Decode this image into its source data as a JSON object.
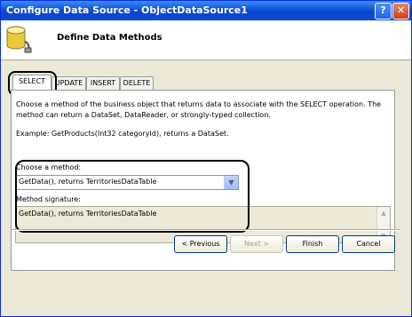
{
  "window": {
    "title": "Configure Data Source - ObjectDataSource1",
    "help_label": "?",
    "close_label": "✕"
  },
  "header": {
    "title": "Define Data Methods"
  },
  "tabs": [
    {
      "label": "SELECT",
      "active": true
    },
    {
      "label": "UPDATE",
      "active": false
    },
    {
      "label": "INSERT",
      "active": false
    },
    {
      "label": "DELETE",
      "active": false
    }
  ],
  "panel": {
    "description": "Choose a method of the business object that returns data to associate with the SELECT operation. The method can return a DataSet, DataReader, or strongly-typed collection.",
    "example": "Example: GetProducts(Int32 categoryId), returns a DataSet.",
    "choose_label": "Choose a method:",
    "method_value": "GetData(), returns TerritoriesDataTable",
    "signature_label": "Method signature:",
    "signature_value": "GetData(), returns TerritoriesDataTable"
  },
  "buttons": {
    "previous": "< Previous",
    "next": "Next >",
    "finish": "Finish",
    "cancel": "Cancel"
  },
  "colors": {
    "titlebar": "#0a46c9",
    "dialog_bg": "#ece9d8"
  }
}
